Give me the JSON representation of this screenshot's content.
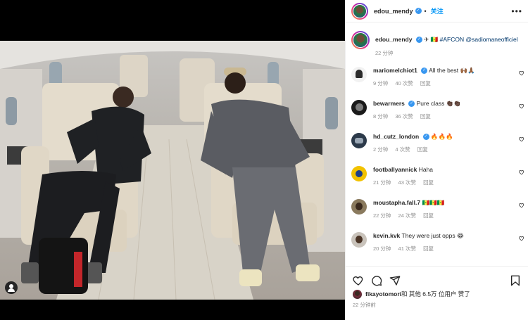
{
  "post": {
    "username": "edou_mendy",
    "follow_label": "关注",
    "more_icon": "more-icon"
  },
  "caption": {
    "username": "edou_mendy",
    "text_prefix": "✈ 🇸🇳 ",
    "hashtag": "#AFCON",
    "mention": "@sadiomaneofficiel",
    "time": "22 分钟"
  },
  "comments": [
    {
      "username": "mariomelchiot1",
      "verified": true,
      "text": "All the best 🙌🏾🙏🏾",
      "time": "9 分钟",
      "likes": "40 次赞",
      "reply": "回复"
    },
    {
      "username": "bewarmers",
      "verified": true,
      "text": "Pure class 👏🏿👏🏿",
      "time": "8 分钟",
      "likes": "36 次赞",
      "reply": "回复"
    },
    {
      "username": "hd_cutz_london",
      "verified": true,
      "text": "🔥🔥🔥",
      "time": "2 分钟",
      "likes": "4 次赞",
      "reply": "回复"
    },
    {
      "username": "footballyannick",
      "verified": false,
      "text": "Haha",
      "time": "21 分钟",
      "likes": "43 次赞",
      "reply": "回复"
    },
    {
      "username": "moustapha.fall.7",
      "verified": false,
      "text": "🇸🇳🇸🇳🇸🇳",
      "time": "22 分钟",
      "likes": "24 次赞",
      "reply": "回复"
    },
    {
      "username": "kevin.kvk",
      "verified": false,
      "text": "They were just opps 😂",
      "time": "20 分钟",
      "likes": "41 次赞",
      "reply": "回复"
    }
  ],
  "likes": {
    "username": "fikayotomori",
    "text": " 和 其他 6.5万 位用户 赞了"
  },
  "timestamp": "22 分钟前",
  "colors": {
    "accent": "#0095f6",
    "verified": "#3897f0",
    "muted": "#8e8e8e"
  }
}
